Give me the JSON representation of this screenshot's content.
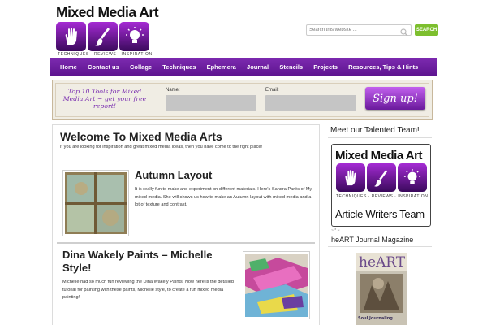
{
  "header": {
    "logo_title": "Mixed Media Art",
    "logo_tagline": "TECHNIQUES · REVIEWS · INSPIRATION",
    "logo_icons": [
      "hand-icon",
      "paintbrush-icon",
      "lightbulb-icon"
    ],
    "search_placeholder": "Search this website ...",
    "search_button": "SEARCH"
  },
  "nav": {
    "items": [
      "Home",
      "Contact us",
      "Collage",
      "Techniques",
      "Ephemera",
      "Journal",
      "Stencils",
      "Projects",
      "Resources, Tips & Hints"
    ]
  },
  "optin": {
    "headline": "Top 10 Tools for Mixed Media Art ~ get your free report!",
    "name_label": "Name:",
    "email_label": "Email:",
    "signup_button": "Sign up!"
  },
  "main": {
    "welcome_title": "Welcome To Mixed Media Arts",
    "welcome_text": "If you are looking for inspiration and great mixed media ideas, then you have come to the right place!",
    "posts": [
      {
        "title": "Autumn Layout",
        "excerpt": "It is really fun to make and experiment on different materials. Here's Sandra Parés of My mixed media. She will shows us how to make an Autumn layout with mixed media and a lot of texture and contrast."
      },
      {
        "title": "Dina Wakely Paints – Michelle Style!",
        "excerpt": "Michelle had so much fun reviewing the Dina Wakely Paints. Now here is the detailed tutorial for painting with these paints, Michelle style, to create a fun mixed media painting!"
      }
    ]
  },
  "sidebar": {
    "team_heading": "Meet our Talented Team!",
    "team_box_title": "Mixed Media Art",
    "team_box_tagline": "TECHNIQUES · REVIEWS · INSPIRATION",
    "team_box_caption": "Article Writers Team",
    "small_text": "~ * ~",
    "journal_heading": "heART Journal Magazine",
    "magazine_title": "heART",
    "magazine_feature": "Soul Journaling"
  },
  "colors": {
    "nav_purple": "#6a1d9c",
    "accent_purple": "#7a2fb0",
    "search_green": "#7dbf2e"
  }
}
